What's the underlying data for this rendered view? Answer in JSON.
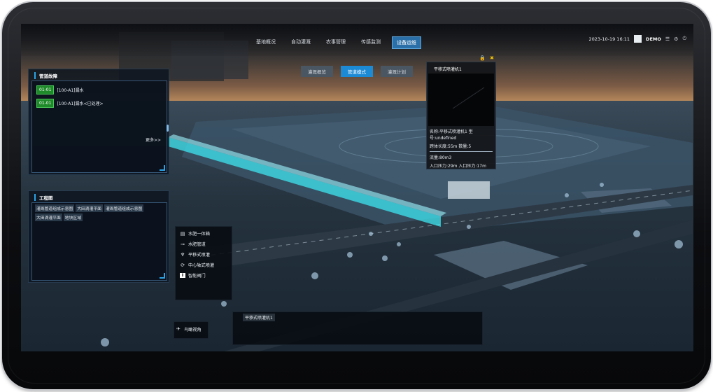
{
  "nav": {
    "tabs": [
      "基地概况",
      "自动灌溉",
      "农事管理",
      "传感监测",
      "设备运维"
    ],
    "active_tab": 4,
    "datetime": "2023-10-19 16:11",
    "user": "DEMO",
    "icons": [
      "menu-icon",
      "settings-icon",
      "power-icon"
    ]
  },
  "fault_panel": {
    "title": "管道故障",
    "items": [
      {
        "time": "01-01",
        "text": "[100-A1]漏水"
      },
      {
        "time": "01-01",
        "text": "[100-A1]漏水<已处理>"
      }
    ],
    "more": "更多>>"
  },
  "project_panel": {
    "title": "工程图",
    "chips": [
      "灌溉管道组成示意图",
      "大田滴灌平面",
      "灌溉管道组成示意图",
      "大田滴灌平面",
      "地块区域"
    ]
  },
  "subtabs": {
    "items": [
      "灌溉概览",
      "管道模式",
      "灌溉计划"
    ],
    "active": 1
  },
  "device_panel": {
    "title": "平移式喷灌机1",
    "lines": [
      "名称:平移式喷灌机1 型号:undefined",
      "跨体长度:55m 数量:5",
      "流量:80m3",
      "入口压力:29m 入口压力:17m"
    ],
    "corner_icons": [
      "lock-icon",
      "close-icon"
    ]
  },
  "legend": {
    "items": [
      {
        "icon": "water-tank-icon",
        "label": "水肥一体箱"
      },
      {
        "icon": "pipe-icon",
        "label": "水肥管道"
      },
      {
        "icon": "sprinkler-icon",
        "label": "平移式喷灌"
      },
      {
        "icon": "pivot-icon",
        "label": "中心轴式喷灌"
      },
      {
        "icon": "valve-icon",
        "label": "智能阀门"
      }
    ]
  },
  "bird_view": {
    "label": "鸟瞰视角",
    "icon": "bird-eye-icon"
  },
  "bottom_panel": {
    "title": "平移式喷灌机1"
  },
  "colors": {
    "accent": "#2aa3e6",
    "highlight_pipe": "#3fe6f0",
    "fault_badge": "#1f8a2a"
  }
}
